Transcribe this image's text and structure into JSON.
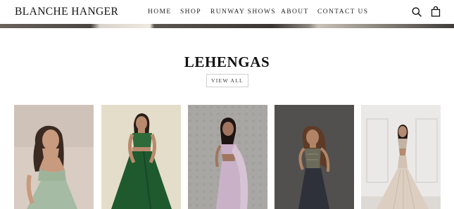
{
  "header": {
    "logo": "BLANCHE HANGER",
    "nav": [
      "HOME",
      "SHOP",
      "RUNWAY SHOWS",
      "ABOUT",
      "CONTACT US"
    ],
    "icons": [
      "search-icon",
      "bag-icon"
    ]
  },
  "section": {
    "title": "LEHENGAS",
    "view_all": "VIEW ALL"
  },
  "products": [
    {
      "name": "sage-green-lehenga",
      "background": "#d8cbc2",
      "outfit": "#9bb39a"
    },
    {
      "name": "emerald-green-lehenga",
      "background": "#e3dcc8",
      "outfit": "#1f5a2e"
    },
    {
      "name": "lilac-printed-saree",
      "background": "#a8a6a3",
      "outfit": "#c8b0c6"
    },
    {
      "name": "charcoal-embroidered-lehenga",
      "background": "#4d4b49",
      "outfit": "#3d3f4a"
    },
    {
      "name": "ivory-fringe-gown",
      "background": "#e8e6e4",
      "outfit": "#d8cbbd"
    }
  ]
}
